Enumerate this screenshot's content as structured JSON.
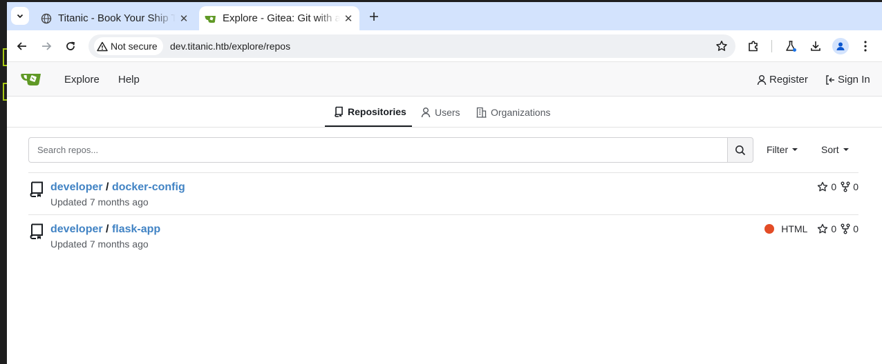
{
  "browser": {
    "tabs": [
      {
        "title": "Titanic - Book Your Ship Trip",
        "active": false
      },
      {
        "title": "Explore - Gitea: Git with a cup of tea",
        "active": true
      }
    ],
    "security_label": "Not secure",
    "url": "dev.titanic.htb/explore/repos"
  },
  "navbar": {
    "explore_label": "Explore",
    "help_label": "Help",
    "register_label": "Register",
    "signin_label": "Sign In"
  },
  "subtabs": {
    "repositories_label": "Repositories",
    "users_label": "Users",
    "organizations_label": "Organizations"
  },
  "search": {
    "placeholder": "Search repos...",
    "filter_label": "Filter",
    "sort_label": "Sort"
  },
  "repos": [
    {
      "owner": "developer",
      "name": "docker-config",
      "updated": "Updated 7 months ago",
      "language": "",
      "language_color": "",
      "stars": "0",
      "forks": "0"
    },
    {
      "owner": "developer",
      "name": "flask-app",
      "updated": "Updated 7 months ago",
      "language": "HTML",
      "language_color": "#e34c26",
      "stars": "0",
      "forks": "0"
    }
  ],
  "colors": {
    "link": "#4183c4",
    "tabstrip": "#d3e3fd",
    "gitea_green": "#609926"
  }
}
